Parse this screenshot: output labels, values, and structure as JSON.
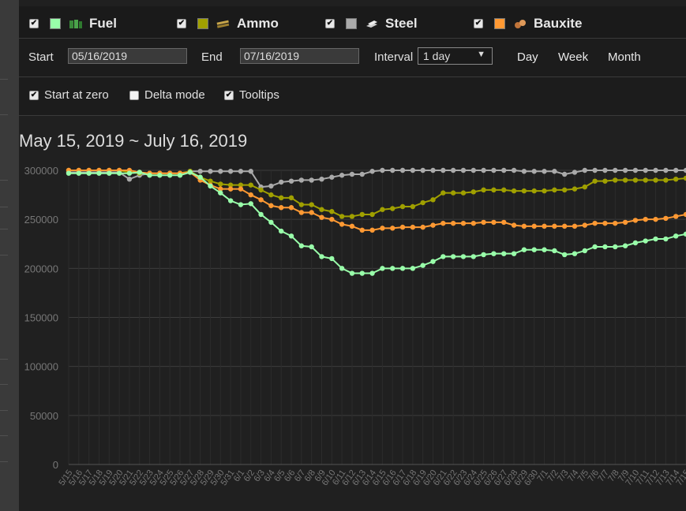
{
  "resources": [
    {
      "label": "Fuel",
      "color": "#99ffaa",
      "checked": true,
      "icon": "fuel-icon"
    },
    {
      "label": "Ammo",
      "color": "#a0a000",
      "checked": true,
      "icon": "ammo-icon"
    },
    {
      "label": "Steel",
      "color": "#aaaaaa",
      "checked": true,
      "icon": "steel-icon"
    },
    {
      "label": "Bauxite",
      "color": "#ff9933",
      "checked": true,
      "icon": "bauxite-icon"
    }
  ],
  "filters": {
    "start_label": "Start",
    "start_value": "05/16/2019",
    "end_label": "End",
    "end_value": "07/16/2019",
    "interval_label": "Interval",
    "interval_value": "1 day",
    "range_buttons": [
      "Day",
      "Week",
      "Month"
    ]
  },
  "options": [
    {
      "label": "Start at zero",
      "checked": true
    },
    {
      "label": "Delta mode",
      "checked": false
    },
    {
      "label": "Tooltips",
      "checked": true
    }
  ],
  "chart_title": "May 15, 2019 ~ July 16, 2019",
  "chart_data": {
    "type": "line",
    "title": "May 15, 2019 ~ July 16, 2019",
    "xlabel": "",
    "ylabel": "",
    "ylim": [
      0,
      300000
    ],
    "yticks": [
      0,
      50000,
      100000,
      150000,
      200000,
      250000,
      300000
    ],
    "grid": true,
    "x": [
      "5/15",
      "5/16",
      "5/17",
      "5/18",
      "5/19",
      "5/20",
      "5/21",
      "5/22",
      "5/23",
      "5/24",
      "5/25",
      "5/26",
      "5/27",
      "5/28",
      "5/29",
      "5/30",
      "5/31",
      "6/1",
      "6/2",
      "6/3",
      "6/4",
      "6/5",
      "6/6",
      "6/7",
      "6/8",
      "6/9",
      "6/10",
      "6/11",
      "6/12",
      "6/13",
      "6/14",
      "6/15",
      "6/16",
      "6/17",
      "6/18",
      "6/19",
      "6/20",
      "6/21",
      "6/22",
      "6/23",
      "6/24",
      "6/25",
      "6/26",
      "6/27",
      "6/28",
      "6/29",
      "6/30",
      "7/1",
      "7/2",
      "7/3",
      "7/4",
      "7/5",
      "7/6",
      "7/7",
      "7/8",
      "7/9",
      "7/10",
      "7/11",
      "7/12",
      "7/13",
      "7/14",
      "7/15"
    ],
    "series": [
      {
        "name": "Steel",
        "color": "#aaaaaa",
        "values": [
          298000,
          298000,
          298000,
          298000,
          298000,
          298000,
          291000,
          295000,
          297000,
          297000,
          297000,
          297000,
          299000,
          299000,
          299000,
          299000,
          299000,
          299000,
          299000,
          283000,
          284000,
          288000,
          289000,
          290000,
          290000,
          291000,
          293000,
          295000,
          296000,
          296000,
          299000,
          300000,
          300000,
          300000,
          300000,
          300000,
          300000,
          300000,
          300000,
          300000,
          300000,
          300000,
          300000,
          300000,
          300000,
          299000,
          299000,
          299000,
          299000,
          296000,
          298000,
          300000,
          300000,
          300000,
          300000,
          300000,
          300000,
          300000,
          300000,
          300000,
          300000,
          300000
        ]
      },
      {
        "name": "Ammo",
        "color": "#a0a000",
        "values": [
          300000,
          300000,
          300000,
          300000,
          300000,
          300000,
          298000,
          297000,
          297000,
          297000,
          297000,
          297000,
          299000,
          293000,
          289000,
          286000,
          285000,
          285000,
          285000,
          280000,
          275000,
          272000,
          272000,
          265000,
          265000,
          260000,
          258000,
          253000,
          253000,
          255000,
          255000,
          260000,
          261000,
          263000,
          263000,
          267000,
          270000,
          277000,
          277000,
          277000,
          278000,
          280000,
          280000,
          280000,
          279000,
          279000,
          279000,
          279000,
          280000,
          280000,
          281000,
          283000,
          289000,
          289000,
          290000,
          290000,
          290000,
          290000,
          290000,
          290000,
          291000,
          292000
        ]
      },
      {
        "name": "Bauxite",
        "color": "#ff9933",
        "values": [
          300000,
          300000,
          300000,
          300000,
          300000,
          300000,
          300000,
          298000,
          297000,
          297000,
          297000,
          297000,
          298000,
          290000,
          285000,
          281000,
          281000,
          281000,
          275000,
          270000,
          264000,
          262000,
          262000,
          257000,
          257000,
          252000,
          250000,
          245000,
          243000,
          239000,
          239000,
          241000,
          241000,
          242000,
          242000,
          242000,
          244000,
          246000,
          246000,
          246000,
          246000,
          247000,
          247000,
          247000,
          244000,
          243000,
          243000,
          243000,
          243000,
          243000,
          243000,
          244000,
          246000,
          246000,
          246000,
          247000,
          249000,
          250000,
          250000,
          251000,
          253000,
          255000
        ]
      },
      {
        "name": "Fuel",
        "color": "#99ffaa",
        "values": [
          297000,
          297000,
          297000,
          297000,
          297000,
          297000,
          297000,
          298000,
          295000,
          295000,
          295000,
          295000,
          298000,
          293000,
          284000,
          277000,
          269000,
          265000,
          266000,
          255000,
          247000,
          238000,
          233000,
          223000,
          222000,
          212000,
          210000,
          200000,
          195000,
          195000,
          195000,
          200000,
          200000,
          200000,
          200000,
          203000,
          207000,
          212000,
          212000,
          212000,
          212000,
          214000,
          215000,
          215000,
          215000,
          219000,
          219000,
          219000,
          218000,
          214000,
          215000,
          218000,
          222000,
          222000,
          222000,
          223000,
          226000,
          228000,
          230000,
          230000,
          233000,
          235000
        ]
      }
    ]
  }
}
